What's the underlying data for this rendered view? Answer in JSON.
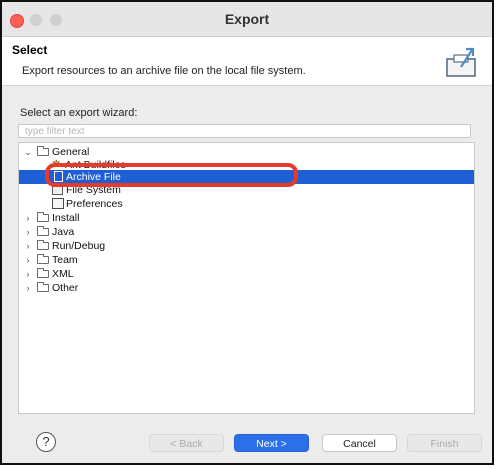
{
  "window": {
    "title": "Export"
  },
  "header": {
    "title": "Select",
    "description": "Export resources to an archive file on the local file system."
  },
  "wizard": {
    "label": "Select an export wizard:",
    "filter_placeholder": "type filter text"
  },
  "tree": {
    "general": "General",
    "ant_buildfiles": "Ant Buildfiles",
    "archive_file": "Archive File",
    "file_system": "File System",
    "preferences": "Preferences",
    "install": "Install",
    "java": "Java",
    "run_debug": "Run/Debug",
    "team": "Team",
    "xml": "XML",
    "other": "Other"
  },
  "footer": {
    "help": "?",
    "back": "< Back",
    "next": "Next >",
    "cancel": "Cancel",
    "finish": "Finish"
  },
  "colors": {
    "selection": "#1f5fd6",
    "primary_button": "#2d6fe8",
    "highlight_ring": "#e63b2a"
  }
}
